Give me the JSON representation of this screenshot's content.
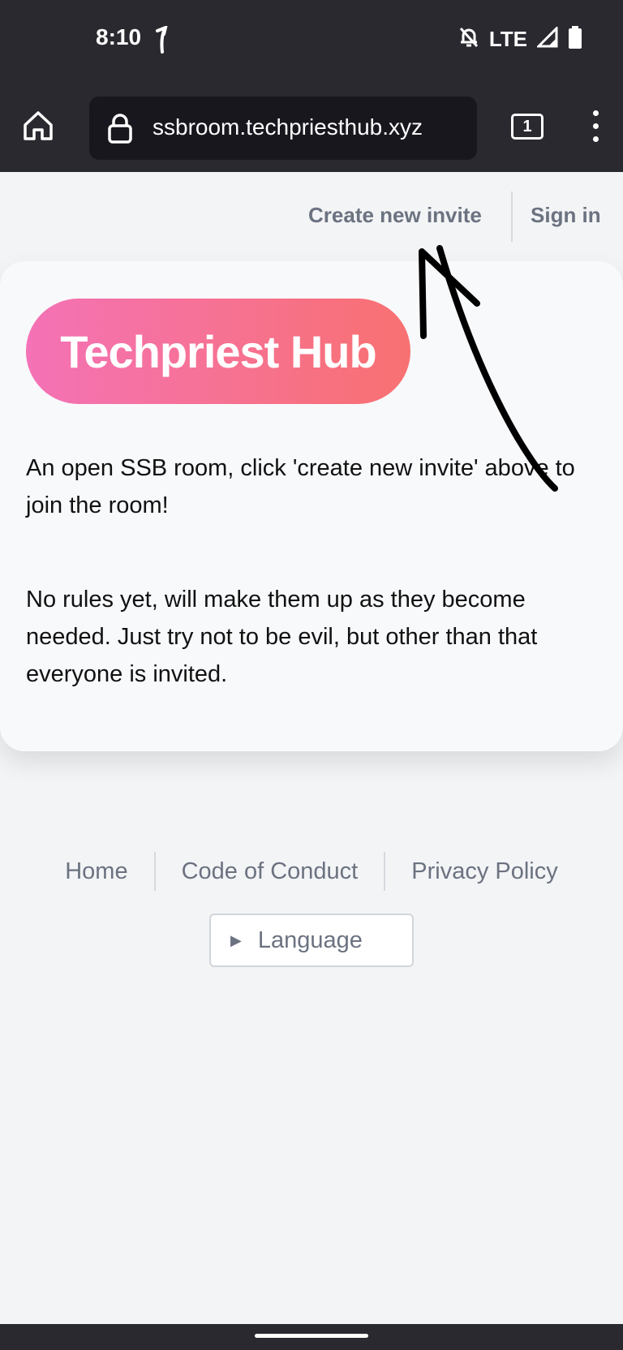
{
  "status_bar": {
    "time": "8:10",
    "network": "LTE"
  },
  "browser": {
    "url": "ssbroom.techpriesthub.xyz",
    "tab_count": "1"
  },
  "top_nav": {
    "create_invite": "Create new invite",
    "sign_in": "Sign in"
  },
  "card": {
    "brand": "Techpriest Hub",
    "paragraph_1": "An open SSB room, click 'create new invite' above to join the room!",
    "paragraph_2": "No rules yet, will make them up as they become needed. Just try not to be evil, but other than that everyone is invited."
  },
  "footer": {
    "links": [
      "Home",
      "Code of Conduct",
      "Privacy Policy"
    ],
    "language_button": "Language"
  },
  "colors": {
    "chrome_bg": "#2a2930",
    "page_bg": "#f3f4f6",
    "muted_text": "#6b7280",
    "brand_gradient_start": "#f472b6",
    "brand_gradient_end": "#f87171"
  }
}
